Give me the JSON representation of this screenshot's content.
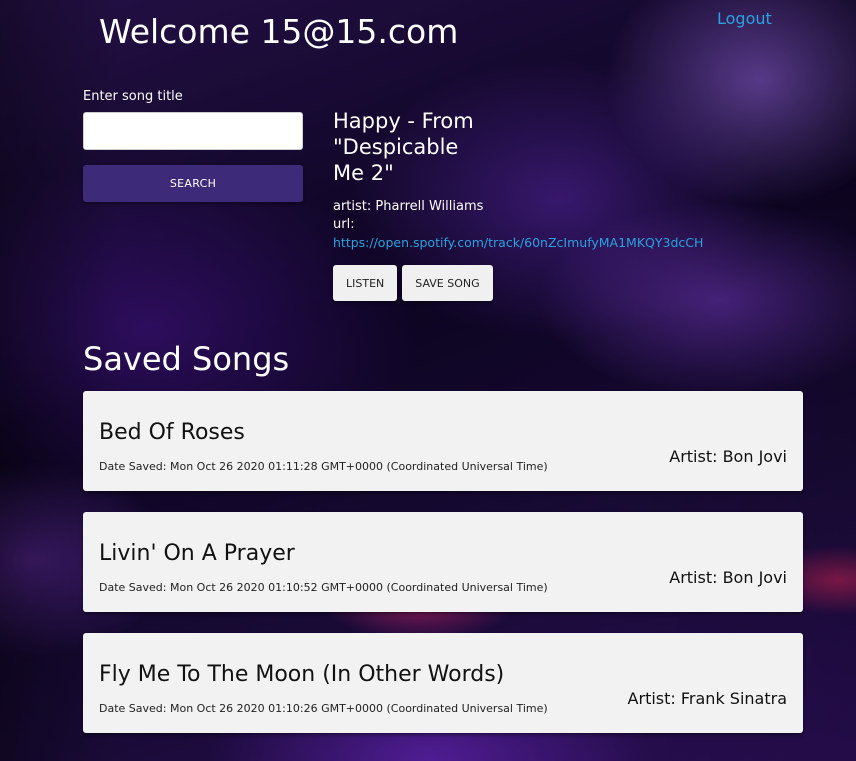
{
  "header": {
    "welcome": "Welcome 15@15.com",
    "logout_label": "Logout"
  },
  "search": {
    "label": "Enter song title",
    "value": "",
    "placeholder": "",
    "button_label": "SEARCH"
  },
  "result": {
    "title": "Happy - From \"Despicable Me 2\"",
    "artist": "artist: Pharrell Williams",
    "url_label": "url:",
    "url": "https://open.spotify.com/track/60nZcImufyMA1MKQY3dcCH",
    "listen_label": "LISTEN",
    "save_label": "SAVE SONG"
  },
  "saved": {
    "heading": "Saved Songs",
    "songs": [
      {
        "title": "Bed Of Roses",
        "date": "Date Saved: Mon Oct 26 2020 01:11:28 GMT+0000 (Coordinated Universal Time)",
        "artist": "Artist: Bon Jovi"
      },
      {
        "title": "Livin' On A Prayer",
        "date": "Date Saved: Mon Oct 26 2020 01:10:52 GMT+0000 (Coordinated Universal Time)",
        "artist": "Artist: Bon Jovi"
      },
      {
        "title": "Fly Me To The Moon (In Other Words)",
        "date": "Date Saved: Mon Oct 26 2020 01:10:26 GMT+0000 (Coordinated Universal Time)",
        "artist": "Artist: Frank Sinatra"
      }
    ]
  },
  "colors": {
    "accent_button": "#3d2a78",
    "link": "#2aa1e0",
    "card_background": "#f2f2f2"
  }
}
